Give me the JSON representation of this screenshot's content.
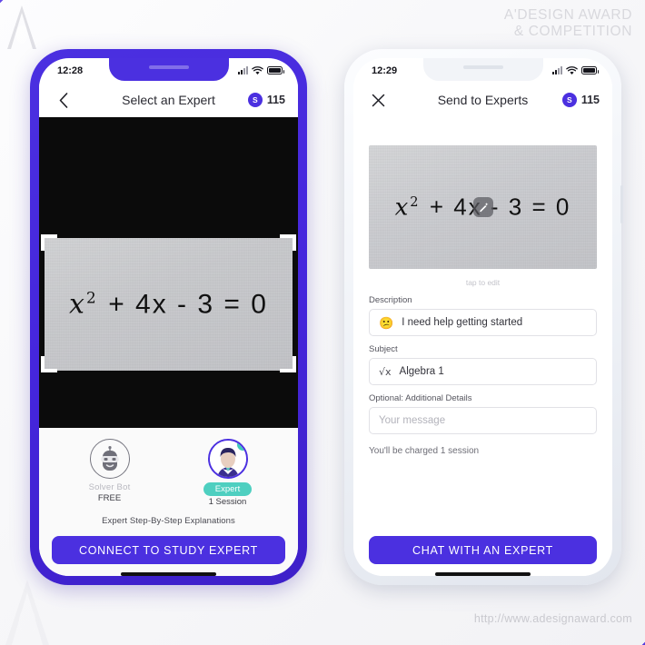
{
  "branding": {
    "award_line1": "A'DESIGN AWARD",
    "award_line2": "& COMPETITION",
    "url": "http://www.adesignaward.com"
  },
  "left_phone": {
    "status": {
      "time": "12:28",
      "signal_icon": "cellular-signal-icon",
      "wifi_icon": "wifi-icon",
      "battery_icon": "battery-icon"
    },
    "nav": {
      "back_icon": "chevron-left-icon",
      "title": "Select an Expert",
      "credit_symbol": "S",
      "credit_count": "115"
    },
    "camera": {
      "equation_base": "x",
      "equation_exp": "2",
      "equation_rest": "+ 4x - 3 = 0",
      "crop_brackets": "capture-frame-brackets"
    },
    "options": [
      {
        "id": "solver-bot",
        "avatar_icon": "robot-icon",
        "label": "Solver Bot",
        "sub": "FREE",
        "style": "plain"
      },
      {
        "id": "expert",
        "avatar_icon": "expert-person-icon",
        "label": "Expert",
        "sub": "1 Session",
        "style": "pill",
        "badge": "i"
      }
    ],
    "caption": "Expert Step-By-Step Explanations",
    "cta_label": "CONNECT TO STUDY EXPERT"
  },
  "right_phone": {
    "status": {
      "time": "12:29",
      "signal_icon": "cellular-signal-icon",
      "wifi_icon": "wifi-icon",
      "battery_icon": "battery-icon"
    },
    "nav": {
      "close_icon": "close-x-icon",
      "title": "Send to Experts",
      "credit_symbol": "S",
      "credit_count": "115"
    },
    "photo": {
      "equation_base": "x",
      "equation_exp": "2",
      "equation_rest": "+ 4x - 3 = 0",
      "magic_icon": "magic-wand-icon"
    },
    "tap_hint": "tap to edit",
    "fields": [
      {
        "label": "Description",
        "value": "I need help getting started",
        "icon": "confused-face-emoji",
        "icon_glyph": "😕",
        "type": "value"
      },
      {
        "label": "Subject",
        "value": "Algebra 1",
        "icon": "square-root-icon",
        "icon_glyph": "√x",
        "type": "value"
      },
      {
        "label": "Optional: Additional Details",
        "placeholder": "Your message",
        "type": "placeholder"
      }
    ],
    "charge_note": "You'll be charged 1 session",
    "cta_label": "CHAT WITH AN EXPERT"
  },
  "colors": {
    "brand_purple": "#4b30e0",
    "teal": "#4ecfc0",
    "page_bg": "#f7f7f9"
  }
}
